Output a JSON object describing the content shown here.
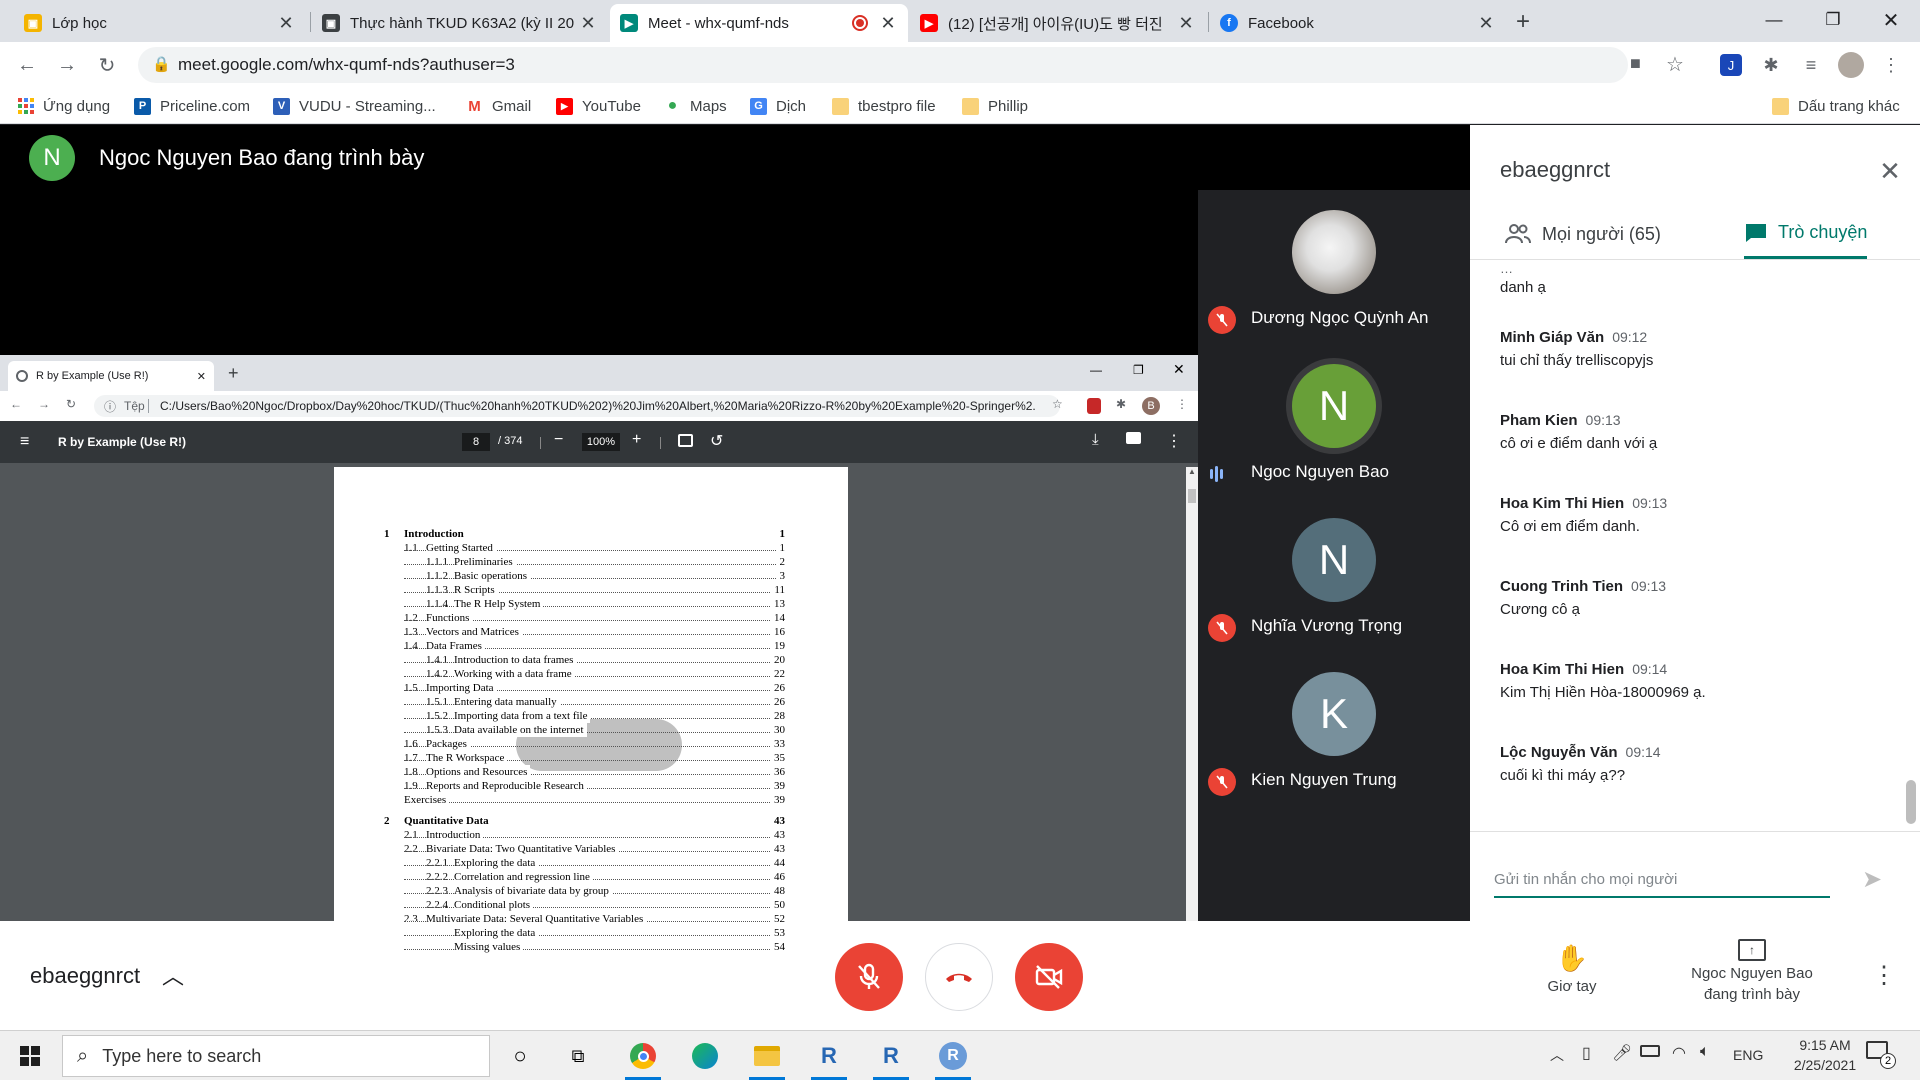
{
  "browser": {
    "tabs": [
      {
        "title": "Lớp học",
        "favicon": "classroom-icon",
        "color": "#f4b400"
      },
      {
        "title": "Thực hành TKUD K63A2 (kỳ II 20",
        "favicon": "classroom-icon",
        "color": "#3c4043"
      },
      {
        "title": "Meet - whx-qumf-nds",
        "favicon": "meet-icon",
        "color": "#00897b",
        "active": true
      },
      {
        "title": "(12) [선공개] 아이유(IU)도 빵 터진",
        "favicon": "youtube-icon",
        "color": "#ff0000"
      },
      {
        "title": "Facebook",
        "favicon": "facebook-icon",
        "color": "#1877f2"
      }
    ],
    "new_tab": "+",
    "address": "meet.google.com/whx-qumf-nds?authuser=3",
    "bookmarks": [
      {
        "label": "Ứng dụng",
        "icon": "apps-grid-icon"
      },
      {
        "label": "Priceline.com",
        "icon": "priceline-icon",
        "color": "#0a5aa9",
        "glyph": "P"
      },
      {
        "label": "VUDU - Streaming...",
        "icon": "vudu-icon",
        "color": "#2d5fb8",
        "glyph": "V"
      },
      {
        "label": "Gmail",
        "icon": "gmail-icon",
        "color": "#ea4335",
        "glyph": "M"
      },
      {
        "label": "YouTube",
        "icon": "youtube-icon",
        "color": "#ff0000",
        "glyph": "▶"
      },
      {
        "label": "Maps",
        "icon": "maps-icon",
        "color": "#34a853",
        "glyph": "●"
      },
      {
        "label": "Dịch",
        "icon": "translate-icon",
        "color": "#4285f4",
        "glyph": "G"
      },
      {
        "label": "tbestpro file",
        "icon": "folder-icon"
      },
      {
        "label": "Phillip",
        "icon": "folder-icon"
      }
    ],
    "other_bookmarks": "Dấu trang khác"
  },
  "meet": {
    "presenter_initial": "N",
    "presenter_banner": "Ngoc Nguyen Bao đang trình bày",
    "shared_window": {
      "tab_title": "R by Example (Use R!)",
      "address_scheme": "Tệp",
      "address": "C:/Users/Bao%20Ngoc/Dropbox/Day%20hoc/TKUD/(Thuc%20hanh%20TKUD%202)%20Jim%20Albert,%20Maria%20Rizzo-R%20by%20Example%20-Springer%2...",
      "profile_initial": "B",
      "pdf_title": "R by Example (Use R!)",
      "page_current": "8",
      "page_total": "/ 374",
      "zoom": "100%",
      "toc": [
        {
          "num": "1",
          "label": "Introduction",
          "page": "1",
          "level": 0
        },
        {
          "num": "1.1",
          "label": "Getting Started",
          "page": "1",
          "level": 1
        },
        {
          "num": "1.1.1",
          "label": "Preliminaries",
          "page": "2",
          "level": 2
        },
        {
          "num": "1.1.2",
          "label": "Basic operations",
          "page": "3",
          "level": 2
        },
        {
          "num": "1.1.3",
          "label": "R Scripts",
          "page": "11",
          "level": 2
        },
        {
          "num": "1.1.4",
          "label": "The R Help System",
          "page": "13",
          "level": 2
        },
        {
          "num": "1.2",
          "label": "Functions",
          "page": "14",
          "level": 1
        },
        {
          "num": "1.3",
          "label": "Vectors and Matrices",
          "page": "16",
          "level": 1
        },
        {
          "num": "1.4",
          "label": "Data Frames",
          "page": "19",
          "level": 1
        },
        {
          "num": "1.4.1",
          "label": "Introduction to data frames",
          "page": "20",
          "level": 2
        },
        {
          "num": "1.4.2",
          "label": "Working with a data frame",
          "page": "22",
          "level": 2
        },
        {
          "num": "1.5",
          "label": "Importing Data",
          "page": "26",
          "level": 1
        },
        {
          "num": "1.5.1",
          "label": "Entering data manually",
          "page": "26",
          "level": 2
        },
        {
          "num": "1.5.2",
          "label": "Importing data from a text file",
          "page": "28",
          "level": 2
        },
        {
          "num": "1.5.3",
          "label": "Data available on the internet",
          "page": "30",
          "level": 2
        },
        {
          "num": "1.6",
          "label": "Packages",
          "page": "33",
          "level": 1
        },
        {
          "num": "1.7",
          "label": "The R Workspace",
          "page": "35",
          "level": 1
        },
        {
          "num": "1.8",
          "label": "Options and Resources",
          "page": "36",
          "level": 1
        },
        {
          "num": "1.9",
          "label": "Reports and Reproducible Research",
          "page": "39",
          "level": 1
        },
        {
          "num": "",
          "label": "Exercises",
          "page": "39",
          "level": 1
        },
        {
          "num": "2",
          "label": "Quantitative Data",
          "page": "43",
          "level": 0,
          "gap": true
        },
        {
          "num": "2.1",
          "label": "Introduction",
          "page": "43",
          "level": 1
        },
        {
          "num": "2.2",
          "label": "Bivariate Data: Two Quantitative Variables",
          "page": "43",
          "level": 1
        },
        {
          "num": "2.2.1",
          "label": "Exploring the data",
          "page": "44",
          "level": 2
        },
        {
          "num": "2.2.2",
          "label": "Correlation and regression line",
          "page": "46",
          "level": 2
        },
        {
          "num": "2.2.3",
          "label": "Analysis of bivariate data by group",
          "page": "48",
          "level": 2
        },
        {
          "num": "2.2.4",
          "label": "Conditional plots",
          "page": "50",
          "level": 2
        },
        {
          "num": "2.3",
          "label": "Multivariate Data: Several Quantitative Variables",
          "page": "52",
          "level": 1
        },
        {
          "num": "2.3.1",
          "label": "Exploring the data",
          "page": "53",
          "level": 2
        },
        {
          "num": "2.3.2",
          "label": "Missing values",
          "page": "54",
          "level": 2
        }
      ]
    },
    "participants": [
      {
        "name": "Dương Ngọc Quỳnh An",
        "initial": "",
        "color": "#d8d8d8",
        "muted": true,
        "photo": true
      },
      {
        "name": "Ngoc Nguyen Bao",
        "initial": "N",
        "color": "#689f38",
        "muted": false,
        "speaking": true
      },
      {
        "name": "Nghĩa Vương Trọng",
        "initial": "N",
        "color": "#546e7a",
        "muted": true
      },
      {
        "name": "Kien Nguyen Trung",
        "initial": "K",
        "color": "#78909c",
        "muted": true
      }
    ]
  },
  "panel": {
    "title": "ebaeggnrct",
    "tab_people": "Mọi người (65)",
    "tab_chat": "Trò chuyện",
    "accent": "#00796b",
    "cut_text": "danh ạ",
    "messages": [
      {
        "sender": "Minh Giáp Văn",
        "time": "09:12",
        "text": "tui chỉ thấy trelliscopyjs"
      },
      {
        "sender": "Pham Kien",
        "time": "09:13",
        "text": "cô ơi e điểm danh với ạ"
      },
      {
        "sender": "Hoa Kim Thi Hien",
        "time": "09:13",
        "text": "Cô ơi em điểm danh."
      },
      {
        "sender": "Cuong Trinh Tien",
        "time": "09:13",
        "text": "Cương cô ạ"
      },
      {
        "sender": "Hoa Kim Thi Hien",
        "time": "09:14",
        "text": "Kim Thị Hiền Hòa-18000969 ạ."
      },
      {
        "sender": "Lộc Nguyễn Văn",
        "time": "09:14",
        "text": "cuối kì thi máy ạ??"
      }
    ],
    "input_placeholder": "Gửi tin nhắn cho mọi người"
  },
  "controls": {
    "meeting_code": "ebaeggnrct",
    "raise_hand": "Giơ tay",
    "presenting_line1": "Ngoc Nguyen Bao",
    "presenting_line2": "đang trình bày",
    "danger_color": "#ea4335"
  },
  "taskbar": {
    "search_placeholder": "Type here to search",
    "language": "ENG",
    "time": "9:15 AM",
    "date": "2/25/2021",
    "notification_count": "2"
  }
}
